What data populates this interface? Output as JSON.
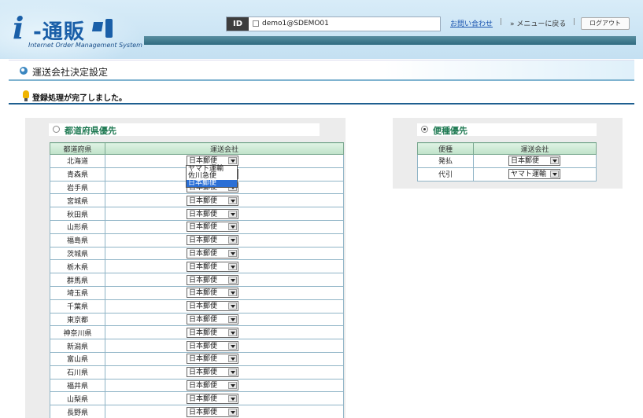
{
  "header": {
    "logo_mark": "i",
    "logo_name": "-通販",
    "logo_sub": "Internet Order Management System",
    "id_tag": "ID",
    "user_id": "demo1@SDEMO01",
    "contact_link": "お問い合わせ",
    "back_link": "» メニューに戻る",
    "logout_button": "ログアウト"
  },
  "page": {
    "title": "運送会社決定設定",
    "notice": "登録処理が完了しました。"
  },
  "left_panel": {
    "heading": "都道府県優先",
    "selected": false,
    "columns": [
      "都道府県",
      "運送会社"
    ],
    "rows": [
      {
        "pref": "北海道",
        "carrier": "日本郵便"
      },
      {
        "pref": "青森県",
        "carrier": "日本郵便"
      },
      {
        "pref": "岩手県",
        "carrier": "日本郵便"
      },
      {
        "pref": "宮城県",
        "carrier": "日本郵便"
      },
      {
        "pref": "秋田県",
        "carrier": "日本郵便"
      },
      {
        "pref": "山形県",
        "carrier": "日本郵便"
      },
      {
        "pref": "福島県",
        "carrier": "日本郵便"
      },
      {
        "pref": "茨城県",
        "carrier": "日本郵便"
      },
      {
        "pref": "栃木県",
        "carrier": "日本郵便"
      },
      {
        "pref": "群馬県",
        "carrier": "日本郵便"
      },
      {
        "pref": "埼玉県",
        "carrier": "日本郵便"
      },
      {
        "pref": "千葉県",
        "carrier": "日本郵便"
      },
      {
        "pref": "東京都",
        "carrier": "日本郵便"
      },
      {
        "pref": "神奈川県",
        "carrier": "日本郵便"
      },
      {
        "pref": "新潟県",
        "carrier": "日本郵便"
      },
      {
        "pref": "富山県",
        "carrier": "日本郵便"
      },
      {
        "pref": "石川県",
        "carrier": "日本郵便"
      },
      {
        "pref": "福井県",
        "carrier": "日本郵便"
      },
      {
        "pref": "山梨県",
        "carrier": "日本郵便"
      },
      {
        "pref": "長野県",
        "carrier": "日本郵便"
      }
    ],
    "dropdown_options": [
      "ヤマト運輸",
      "佐川急便",
      "日本郵便"
    ],
    "dropdown_highlighted": "日本郵便"
  },
  "right_panel": {
    "heading": "便種優先",
    "selected": true,
    "columns": [
      "便種",
      "運送会社"
    ],
    "rows": [
      {
        "type": "発払",
        "carrier": "日本郵便"
      },
      {
        "type": "代引",
        "carrier": "ヤマト運輸"
      }
    ]
  }
}
